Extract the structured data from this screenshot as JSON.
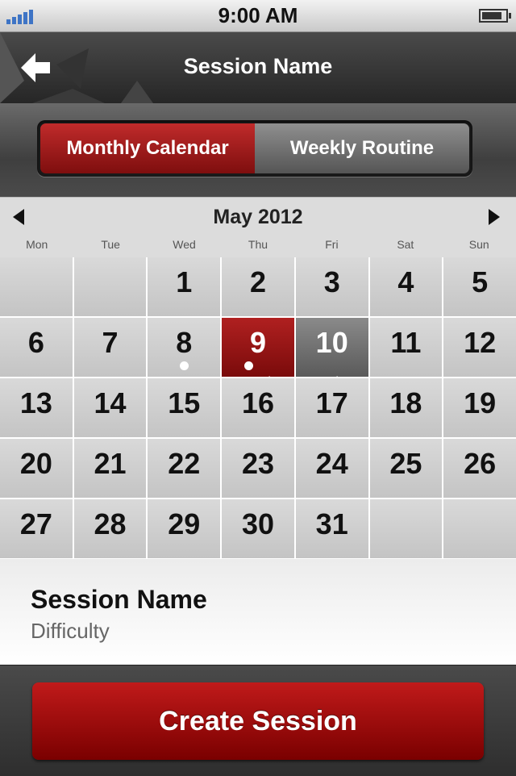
{
  "status_bar": {
    "time": "9:00 AM",
    "signal_bars": 5,
    "battery_level": 0.85
  },
  "nav": {
    "title": "Session Name",
    "back_icon": "back-arrow-icon"
  },
  "segments": [
    {
      "label": "Monthly Calendar",
      "active": true
    },
    {
      "label": "Weekly Routine",
      "active": false
    }
  ],
  "calendar": {
    "month_label": "May 2012",
    "weekdays": [
      "Mon",
      "Tue",
      "Wed",
      "Thu",
      "Fri",
      "Sat",
      "Sun"
    ],
    "days": [
      {
        "day": ""
      },
      {
        "day": ""
      },
      {
        "day": "1"
      },
      {
        "day": "2"
      },
      {
        "day": "3"
      },
      {
        "day": "4"
      },
      {
        "day": "5"
      },
      {
        "day": "6"
      },
      {
        "day": "7"
      },
      {
        "day": "8",
        "dot": true
      },
      {
        "day": "9",
        "dot": true,
        "check": true,
        "state": "today"
      },
      {
        "day": "10",
        "check": true,
        "state": "selected"
      },
      {
        "day": "11"
      },
      {
        "day": "12"
      },
      {
        "day": "13"
      },
      {
        "day": "14"
      },
      {
        "day": "15"
      },
      {
        "day": "16"
      },
      {
        "day": "17"
      },
      {
        "day": "18"
      },
      {
        "day": "19"
      },
      {
        "day": "20"
      },
      {
        "day": "21"
      },
      {
        "day": "22"
      },
      {
        "day": "23"
      },
      {
        "day": "24"
      },
      {
        "day": "25"
      },
      {
        "day": "26"
      },
      {
        "day": "27"
      },
      {
        "day": "28"
      },
      {
        "day": "29"
      },
      {
        "day": "30"
      },
      {
        "day": "31"
      },
      {
        "day": ""
      },
      {
        "day": ""
      }
    ]
  },
  "session_info": {
    "name": "Session Name",
    "difficulty": "Difficulty"
  },
  "footer": {
    "create_label": "Create Session"
  },
  "colors": {
    "accent_red": "#9e1515",
    "selected_gray": "#6e6e6e",
    "signal_blue": "#3e74c5"
  }
}
